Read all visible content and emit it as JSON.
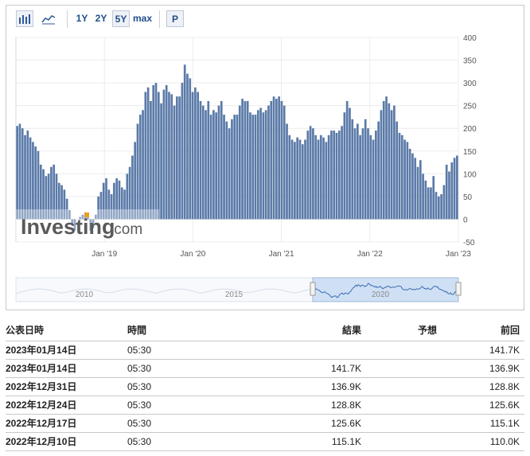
{
  "toolbar": {
    "bar_chart_icon": "bar-chart-icon",
    "line_chart_icon": "line-chart-icon",
    "ranges": [
      "1Y",
      "2Y",
      "5Y",
      "max"
    ],
    "selected_range": "5Y",
    "p_button": "P"
  },
  "watermark": "Investing",
  "watermark_suffix": ".com",
  "navigator": {
    "labels": [
      "2010",
      "2015",
      "2020"
    ]
  },
  "table": {
    "headers": [
      "公表日時",
      "時間",
      "結果",
      "予想",
      "前回"
    ],
    "rows": [
      [
        "2023年01月14日",
        "05:30",
        "",
        "",
        "141.7K"
      ],
      [
        "2023年01月14日",
        "05:30",
        "141.7K",
        "",
        "136.9K"
      ],
      [
        "2022年12月31日",
        "05:30",
        "136.9K",
        "",
        "128.8K"
      ],
      [
        "2022年12月24日",
        "05:30",
        "128.8K",
        "",
        "125.6K"
      ],
      [
        "2022年12月17日",
        "05:30",
        "125.6K",
        "",
        "115.1K"
      ],
      [
        "2022年12月10日",
        "05:30",
        "115.1K",
        "",
        "110.0K"
      ]
    ]
  },
  "chart_data": {
    "type": "bar",
    "bar_color": "#5b7aa8",
    "ylim": [
      -50,
      400
    ],
    "yticks": [
      400,
      350,
      300,
      250,
      200,
      150,
      100,
      50,
      0,
      -50
    ],
    "xtick_labels": [
      "Jan '19",
      "Jan '20",
      "Jan '21",
      "Jan '22",
      "Jan '23"
    ],
    "x_start": "2018-01",
    "x_end": "2023-01",
    "values": [
      205,
      210,
      200,
      185,
      195,
      180,
      170,
      160,
      150,
      120,
      110,
      95,
      100,
      115,
      120,
      100,
      80,
      75,
      65,
      45,
      20,
      -10,
      -25,
      0,
      5,
      10,
      15,
      5,
      -25,
      -20,
      10,
      50,
      60,
      80,
      90,
      65,
      55,
      80,
      90,
      85,
      70,
      65,
      100,
      115,
      140,
      170,
      210,
      230,
      240,
      280,
      290,
      260,
      295,
      300,
      280,
      255,
      285,
      295,
      280,
      275,
      250,
      270,
      270,
      300,
      340,
      320,
      310,
      280,
      290,
      280,
      260,
      250,
      240,
      260,
      230,
      240,
      235,
      250,
      260,
      230,
      215,
      200,
      220,
      230,
      230,
      250,
      265,
      260,
      260,
      235,
      230,
      230,
      240,
      245,
      235,
      240,
      250,
      260,
      270,
      265,
      270,
      260,
      250,
      210,
      185,
      175,
      170,
      180,
      175,
      165,
      175,
      195,
      205,
      200,
      185,
      175,
      185,
      180,
      170,
      185,
      195,
      195,
      190,
      195,
      205,
      235,
      260,
      245,
      220,
      200,
      210,
      185,
      200,
      220,
      200,
      185,
      175,
      195,
      215,
      240,
      260,
      270,
      255,
      240,
      250,
      215,
      190,
      185,
      175,
      170,
      155,
      145,
      135,
      115,
      130,
      100,
      85,
      70,
      70,
      95,
      60,
      50,
      55,
      75,
      120,
      105,
      125,
      135,
      140
    ],
    "navigator_x_labels": [
      "2010",
      "2015",
      "2020"
    ]
  }
}
